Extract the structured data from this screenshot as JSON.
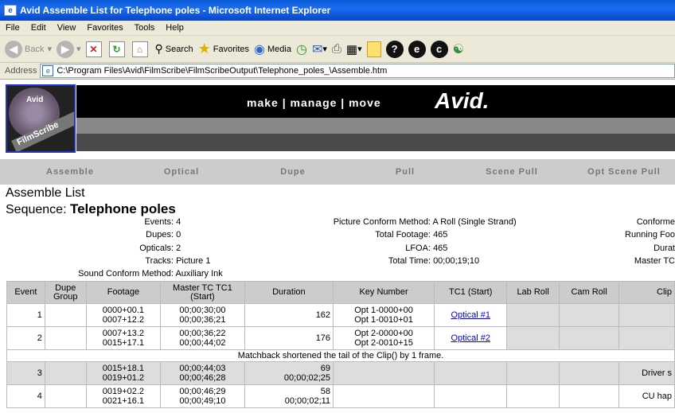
{
  "window": {
    "title": "Avid Assemble List for Telephone poles - Microsoft Internet Explorer"
  },
  "menu": [
    "File",
    "Edit",
    "View",
    "Favorites",
    "Tools",
    "Help"
  ],
  "toolbar": {
    "back": "Back",
    "search": "Search",
    "favorites": "Favorites",
    "media": "Media"
  },
  "address": {
    "label": "Address",
    "url": "C:\\Program Files\\Avid\\FilmScribe\\FilmScribeOutput\\Telephone_poles_\\Assemble.htm"
  },
  "banner": {
    "tagline": "make | manage | move",
    "brand": "Avid.",
    "logo_text": "FilmScribe",
    "logo_small": "Avid"
  },
  "nav": [
    "Assemble",
    "Optical",
    "Dupe",
    "Pull",
    "Scene Pull",
    "Opt Scene Pull"
  ],
  "report": {
    "title": "Assemble List",
    "sequence_label": "Sequence:",
    "sequence_name": "Telephone poles"
  },
  "meta_left": [
    {
      "k": "Events:",
      "v": "4"
    },
    {
      "k": "Dupes:",
      "v": "0"
    },
    {
      "k": "Opticals:",
      "v": "2"
    },
    {
      "k": "Tracks:",
      "v": "Picture 1"
    },
    {
      "k": "Sound Conform Method:",
      "v": "Auxiliary Ink"
    }
  ],
  "meta_mid": [
    {
      "k": "Picture Conform Method:",
      "v": "A Roll (Single Strand)"
    },
    {
      "k": "Total Footage:",
      "v": "465"
    },
    {
      "k": "LFOA:",
      "v": "465"
    },
    {
      "k": "Total Time:",
      "v": "00;00;19;10"
    }
  ],
  "meta_right": [
    "Conforme",
    "Running Foo",
    "Durat",
    "Master TC"
  ],
  "table": {
    "headers": [
      "Event",
      "Dupe Group",
      "Footage",
      "Master TC TC1 (Start)",
      "Duration",
      "Key Number",
      "TC1 (Start)",
      "Lab Roll",
      "Cam Roll",
      "Clip"
    ],
    "rows": [
      {
        "event": "1",
        "footage": [
          "0000+00.1",
          "0007+12.2"
        ],
        "mastertc": [
          "00;00;30;00",
          "00;00;36;21"
        ],
        "duration": [
          "162"
        ],
        "key": [
          "Opt 1-0000+00",
          "Opt 1-0010+01"
        ],
        "tc1": "Optical #1",
        "clip": ""
      },
      {
        "event": "2",
        "footage": [
          "0007+13.2",
          "0015+17.1"
        ],
        "mastertc": [
          "00;00;36;22",
          "00;00;44;02"
        ],
        "duration": [
          "176"
        ],
        "key": [
          "Opt 2-0000+00",
          "Opt 2-0010+15"
        ],
        "tc1": "Optical #2",
        "clip": ""
      },
      {
        "event": "3",
        "footage": [
          "0015+18.1",
          "0019+01.2"
        ],
        "mastertc": [
          "00;00;44;03",
          "00;00;46;28"
        ],
        "duration": [
          "69",
          "00;00;02;25"
        ],
        "key": [
          "",
          ""
        ],
        "tc1": "",
        "clip": "Driver s"
      },
      {
        "event": "4",
        "footage": [
          "0019+02.2",
          "0021+16.1"
        ],
        "mastertc": [
          "00;00;46;29",
          "00;00;49;10"
        ],
        "duration": [
          "58",
          "00;00;02;11"
        ],
        "key": [
          "",
          ""
        ],
        "tc1": "",
        "clip": "CU hap"
      }
    ],
    "note": "Matchback shortened the tail of the Clip() by 1 frame."
  }
}
